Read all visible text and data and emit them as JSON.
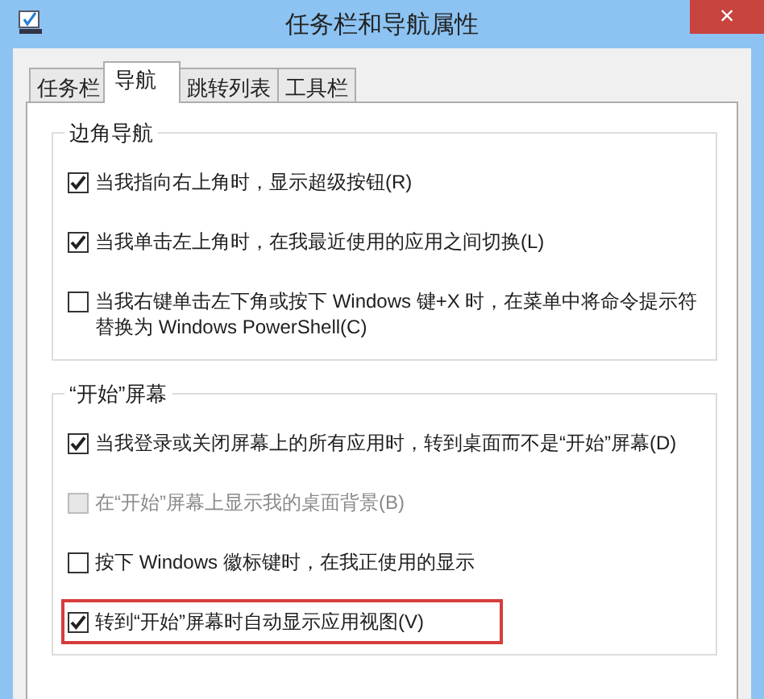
{
  "window": {
    "title": "任务栏和导航属性",
    "close": "×"
  },
  "tabs": [
    {
      "label": "任务栏",
      "selected": false
    },
    {
      "label": "导航",
      "selected": true
    },
    {
      "label": "跳转列表",
      "selected": false
    },
    {
      "label": "工具栏",
      "selected": false
    }
  ],
  "groups": [
    {
      "title": "边角导航",
      "options": [
        {
          "label": "当我指向右上角时，显示超级按钮(R)",
          "checked": true,
          "disabled": false,
          "highlighted": false
        },
        {
          "label": "当我单击左上角时，在我最近使用的应用之间切换(L)",
          "checked": true,
          "disabled": false,
          "highlighted": false
        },
        {
          "label": "当我右键单击左下角或按下 Windows 键+X 时，在菜单中将命令提示符替换为 Windows PowerShell(C)",
          "checked": false,
          "disabled": false,
          "highlighted": false
        }
      ]
    },
    {
      "title": "“开始”屏幕",
      "options": [
        {
          "label": "当我登录或关闭屏幕上的所有应用时，转到桌面而不是“开始”屏幕(D)",
          "checked": true,
          "disabled": false,
          "highlighted": false
        },
        {
          "label": "在“开始”屏幕上显示我的桌面背景(B)",
          "checked": false,
          "disabled": true,
          "highlighted": false
        },
        {
          "label": "按下 Windows 徽标键时，在我正使用的显示",
          "checked": false,
          "disabled": false,
          "highlighted": false
        },
        {
          "label": "转到“开始”屏幕时自动显示应用视图(V)",
          "checked": true,
          "disabled": false,
          "highlighted": true
        }
      ]
    }
  ]
}
